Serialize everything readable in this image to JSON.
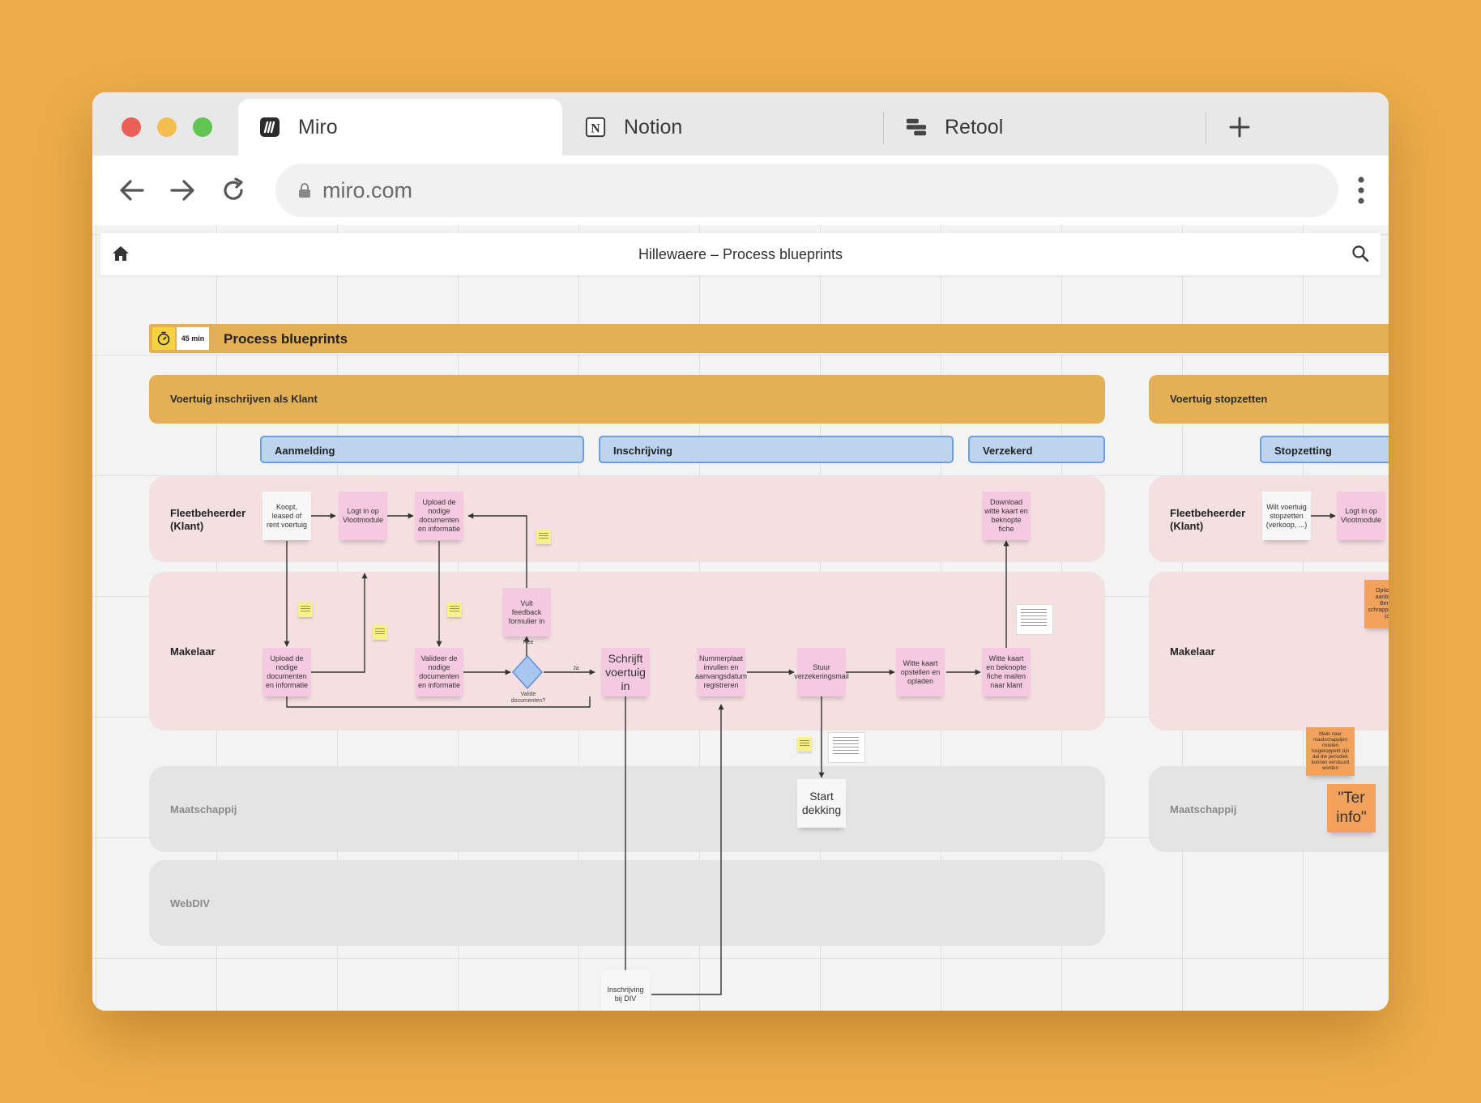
{
  "browser": {
    "tabs": [
      {
        "label": "Miro",
        "icon": "miro-icon",
        "active": true
      },
      {
        "label": "Notion",
        "icon": "notion-icon",
        "active": false
      },
      {
        "label": "Retool",
        "icon": "retool-icon",
        "active": false
      }
    ],
    "new_tab_icon": "plus-icon",
    "url": "miro.com",
    "traffic_lights": [
      "#EC5F59",
      "#F4BE4F",
      "#61C554"
    ]
  },
  "board": {
    "title": "Hillewaere – Process blueprints",
    "header": {
      "timer": "45 min",
      "title": "Process blueprints"
    },
    "sections": [
      {
        "title": "Voertuig inschrijven als Klant",
        "phases": [
          "Aanmelding",
          "Inschrijving",
          "Verzekerd"
        ],
        "lanes": [
          "Fleetbeheerder\n(Klant)",
          "Makelaar",
          "Maatschappij",
          "WebDIV"
        ],
        "stickies": [
          "Koopt, leased of rent voertuig",
          "Logt in op Vlootmodule",
          "Upload de nodige documenten en informatie",
          "Download witte kaart en beknopte fiche",
          "Vult feedback formulier in",
          "Upload de nodige documenten en informatie",
          "Valideer de nodige documenten en informatie",
          "Schrijft voertuig in",
          "Nummerplaat invullen en aanvangsdatum registreren",
          "Stuur verzekeringsmail",
          "Witte kaart opstellen en opladen",
          "Witte kaart en beknopte fiche mailen naar klant",
          "Start dekking",
          "Inschrijving bij DIV"
        ],
        "decision_labels": {
          "no": "Nee",
          "yes": "Ja",
          "question": "Valide documenten?"
        }
      },
      {
        "title": "Voertuig stopzetten",
        "phases": [
          "Stopzetting"
        ],
        "lanes": [
          "Fleetbeheerder\n(Klant)",
          "Makelaar",
          "Maatschappij"
        ],
        "stickies": [
          "Wilt voertuig stopzetten (verkoop, ...)",
          "Logt in op Vlootmodule",
          "Optioneel: aanbieden Bericht schrapping plaat (de",
          "Mails naar maatschappijen moeten losgekoppeld zijn dat die periodiek kunnen verstuurd worden",
          "\"Ter info\""
        ]
      }
    ]
  },
  "colors": {
    "background": "#EDAD4A",
    "banner": "#E3B055",
    "phase_fill": "#BDD4EE",
    "phase_border": "#6D9FE0",
    "lane_pink": "#F4DFE1",
    "lane_grey": "#E4E4E4",
    "sticky_pink": "#F5C9DF",
    "sticky_orange": "#F2A25A"
  }
}
